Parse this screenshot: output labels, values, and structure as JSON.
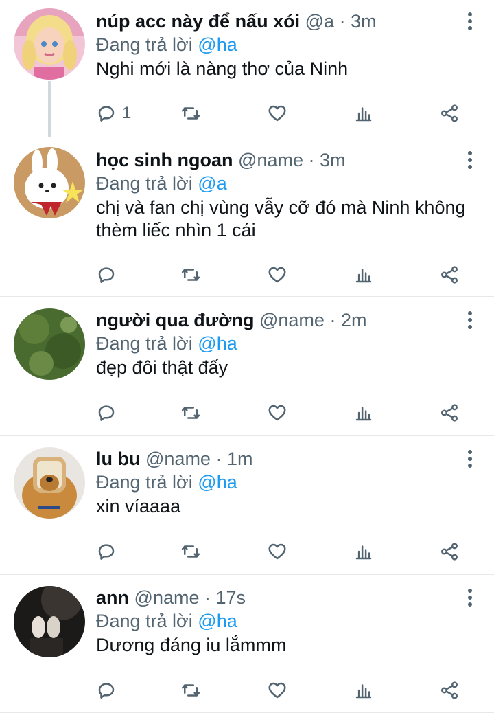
{
  "colors": {
    "accent": "#1d9bf0",
    "muted": "#536471",
    "text": "#0f1419",
    "separator": "#e6e9ec"
  },
  "tweets": [
    {
      "name": "núp acc này để nấu xói",
      "handle": "@a",
      "dot": "·",
      "time": "3m",
      "reply_prefix": "Đang trả lời",
      "reply_to": "@ha",
      "text": "Nghi mới là nàng thơ của Ninh",
      "reply_count": "1",
      "avatar": "doll-avatar"
    },
    {
      "name": "học sinh ngoan",
      "handle": "@name",
      "dot": "·",
      "time": "3m",
      "reply_prefix": "Đang trả lời",
      "reply_to": "@a",
      "text": "chị và fan chị vùng vẫy cỡ đó mà Ninh không thèm liếc nhìn 1 cái",
      "reply_count": "",
      "avatar": "bunny-avatar"
    },
    {
      "name": "người qua đường",
      "handle": "@name",
      "dot": "·",
      "time": "2m",
      "reply_prefix": "Đang trả lời",
      "reply_to": "@ha",
      "text": "đẹp đôi thật đấy",
      "reply_count": "",
      "avatar": "grass-avatar"
    },
    {
      "name": "lu bu",
      "handle": "@name",
      "dot": "·",
      "time": "1m",
      "reply_prefix": "Đang trả lời",
      "reply_to": "@ha",
      "text": "xin víaaaa",
      "reply_count": "",
      "avatar": "dog-avatar"
    },
    {
      "name": "ann",
      "handle": "@name",
      "dot": "·",
      "time": "17s",
      "reply_prefix": "Đang trả lời",
      "reply_to": "@ha",
      "text": "Dương đáng iu lắmmm",
      "reply_count": "",
      "avatar": "feet-avatar"
    }
  ]
}
